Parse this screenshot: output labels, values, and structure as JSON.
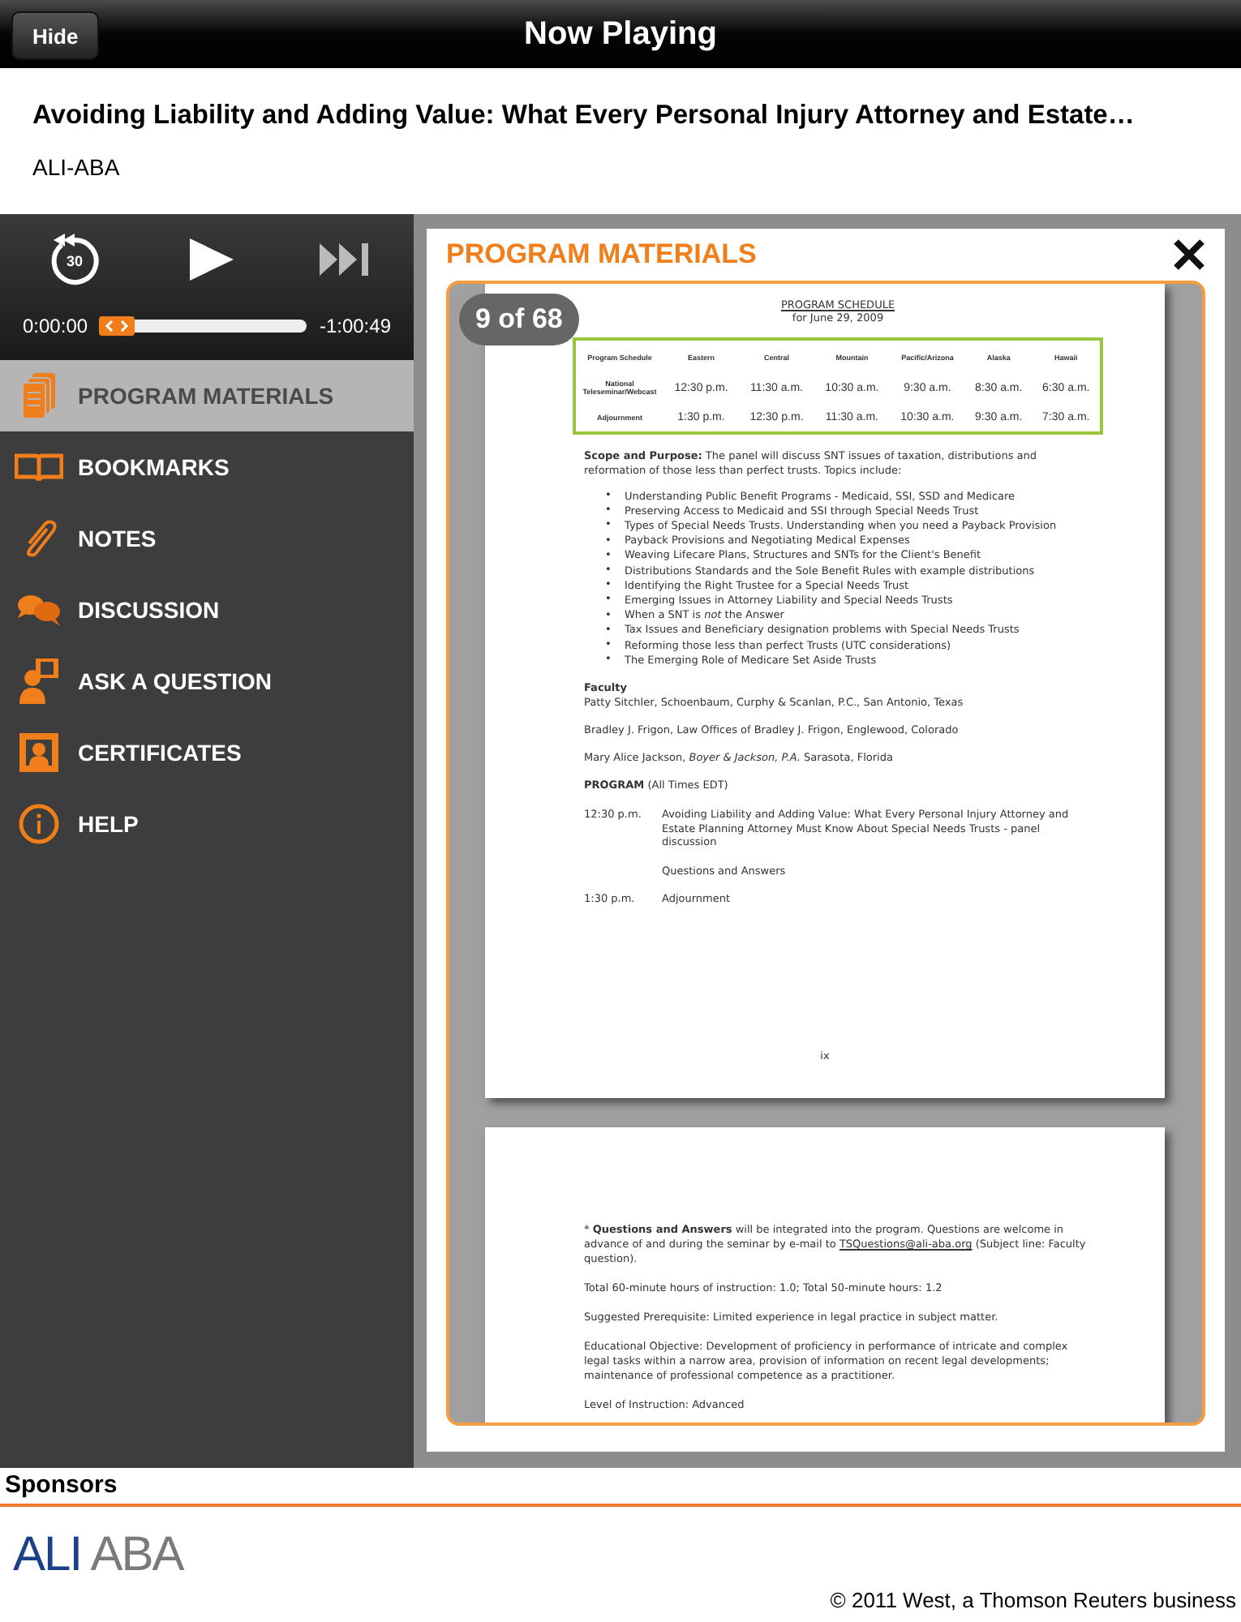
{
  "top_bar": {
    "title": "Now Playing",
    "hide_button": "Hide"
  },
  "header": {
    "title": "Avoiding Liability and Adding Value: What Every Personal Injury Attorney and Estate…",
    "publisher": "ALI-ABA"
  },
  "player": {
    "replay_label": "30",
    "elapsed": "0:00:00",
    "remaining": "-1:00:49",
    "level": 0.08
  },
  "sidebar": {
    "items": [
      {
        "label": "PROGRAM MATERIALS",
        "kind": "pages",
        "selected": true
      },
      {
        "label": "BOOKMARKS",
        "kind": "book",
        "selected": false
      },
      {
        "label": "NOTES",
        "kind": "clip",
        "selected": false
      },
      {
        "label": "DISCUSSION",
        "kind": "chat",
        "selected": false
      },
      {
        "label": "ASK A QUESTION",
        "kind": "ask",
        "selected": false
      },
      {
        "label": "CERTIFICATES",
        "kind": "cert",
        "selected": false
      },
      {
        "label": "HELP",
        "kind": "info",
        "selected": false
      }
    ]
  },
  "panel": {
    "title": "PROGRAM MATERIALS",
    "page_counter": "9 of 68",
    "page_1": {
      "heading": "PROGRAM SCHEDULE",
      "date": "for June 29, 2009",
      "schedule": {
        "columns": [
          "Program Schedule",
          "Eastern",
          "Central",
          "Mountain",
          "Pacific/Arizona",
          "Alaska",
          "Hawaii"
        ],
        "rows": [
          [
            "National Teleseminar/Webcast",
            "12:30 p.m.",
            "11:30 a.m.",
            "10:30 a.m.",
            "9:30 a.m.",
            "8:30 a.m.",
            "6:30 a.m."
          ],
          [
            "Adjournment",
            "1:30 p.m.",
            "12:30 p.m.",
            "11:30 a.m.",
            "10:30 a.m.",
            "9:30 a.m.",
            "7:30 a.m."
          ]
        ]
      },
      "scope": "**Scope and Purpose:**  The panel will discuss SNT issues of taxation, distributions and reformation of those less than perfect trusts.  Topics include:",
      "bullet": "•",
      "topics": [
        "Understanding Public Benefit Programs - Medicaid, SSI, SSD and Medicare",
        "Preserving Access to Medicaid and SSI through Special Needs Trust",
        "Types of Special Needs Trusts. Understanding when you need a Payback Provision",
        "Payback Provisions and Negotiating Medical Expenses",
        "Weaving Lifecare Plans, Structures and SNTs for the Client's Benefit",
        "Distributions Standards and the Sole Benefit Rules with example distributions",
        "Identifying the Right Trustee for a Special Needs Trust",
        "Emerging Issues in Attorney Liability and Special Needs Trusts",
        "When a SNT is *not* the Answer",
        "Tax Issues and Beneficiary designation problems with Special Needs Trusts",
        "Reforming those less than perfect Trusts (UTC considerations)",
        "The Emerging Role of Medicare Set Aside Trusts"
      ],
      "faculty_heading": "Faculty",
      "faculty": [
        "Patty Sitchler, Schoenbaum, Curphy & Scanlan, P.C., San Antonio, Texas",
        "Bradley J. Frigon, Law Offices of Bradley J. Frigon, Englewood, Colorado",
        "Mary Alice Jackson, *Boyer & Jackson, P.A.* Sarasota, Florida"
      ],
      "program_heading": "**PROGRAM** (All Times EDT)",
      "program": [
        {
          "time": "12:30 p.m.",
          "entries": [
            "Avoiding Liability and Adding Value: What Every Personal Injury Attorney and Estate Planning Attorney Must Know About Special Needs Trusts - panel discussion",
            "Questions and Answers"
          ]
        },
        {
          "time": "1:30 p.m.",
          "entries": [
            "Adjournment"
          ]
        }
      ],
      "page_number": "ix"
    },
    "page_2": {
      "note_mark": "*",
      "note_before": "**Questions and Answers** will be integrated into the program. Questions are welcome in advance of and during the seminar by e-mail to",
      "note_link": "TSQuestions@ali-aba.org",
      "note_after": "(Subject line: Faculty question).",
      "paragraphs": [
        "Total 60-minute hours of instruction: 1.0; Total 50-minute hours: 1.2",
        "Suggested Prerequisite: Limited experience in legal practice in subject matter.",
        "Educational Objective: Development of proficiency in performance of intricate and complex legal tasks within a narrow area, provision of information on recent legal developments; maintenance of professional competence as a practitioner.",
        "Level of Instruction: Advanced"
      ]
    }
  },
  "footer": {
    "heading": "Sponsors",
    "logo_left": "ALI",
    "logo_right": "ABA",
    "copyright": "© 2011 West, a Thomson Reuters business"
  }
}
